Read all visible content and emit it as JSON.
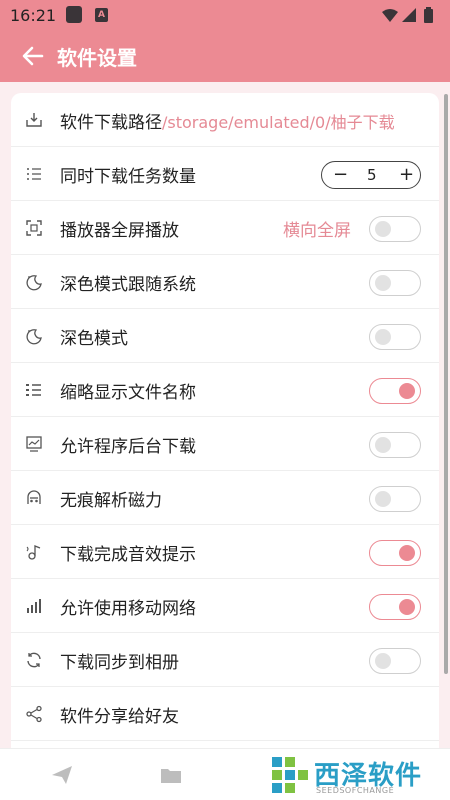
{
  "status_bar": {
    "time": "16:21",
    "notif_letter": "A"
  },
  "app_bar": {
    "title": "软件设置"
  },
  "settings": {
    "download_path": {
      "label": "软件下载路径",
      "value": "/storage/emulated/0/柚子下载"
    },
    "concurrent_tasks": {
      "label": "同时下载任务数量",
      "value": "5",
      "minus": "−",
      "plus": "+"
    },
    "player_fullscreen": {
      "label": "播放器全屏播放",
      "mode": "横向全屏",
      "enabled": false
    },
    "dark_follow_system": {
      "label": "深色模式跟随系统",
      "enabled": false
    },
    "dark_mode": {
      "label": "深色模式",
      "enabled": false
    },
    "abbrev_filename": {
      "label": "缩略显示文件名称",
      "enabled": true
    },
    "background_download": {
      "label": "允许程序后台下载",
      "enabled": false
    },
    "incognito_magnet": {
      "label": "无痕解析磁力",
      "enabled": false
    },
    "download_sound": {
      "label": "下载完成音效提示",
      "enabled": true
    },
    "mobile_network": {
      "label": "允许使用移动网络",
      "enabled": true
    },
    "sync_album": {
      "label": "下载同步到相册",
      "enabled": false
    },
    "share": {
      "label": "软件分享给好友"
    }
  },
  "watermark": {
    "text": "西泽软件",
    "sub": "SEEDSOFCHANGE"
  },
  "colors": {
    "accent": "#ec8a93",
    "toggle_off": "#e2e2e2",
    "watermark": "#2a9ec6"
  }
}
